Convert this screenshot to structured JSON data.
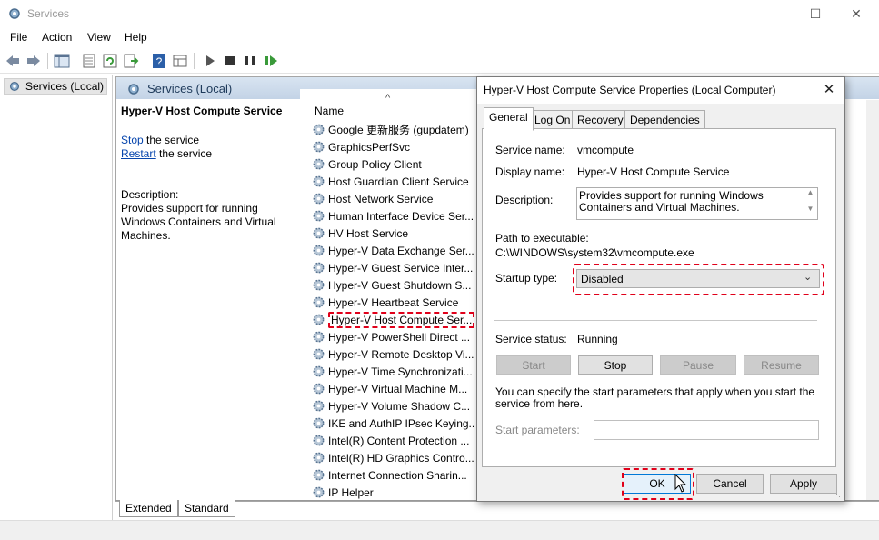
{
  "window": {
    "title": "Services",
    "controls": [
      "minimize",
      "maximize",
      "close"
    ]
  },
  "menu": [
    "File",
    "Action",
    "View",
    "Help"
  ],
  "toolbar": {
    "icons": [
      "back-icon",
      "forward-icon",
      "show-hide-tree-icon",
      "properties-icon",
      "refresh-icon",
      "export-icon",
      "help-icon",
      "view-icon",
      "start-icon",
      "stop-icon",
      "pause-icon",
      "restart-icon"
    ]
  },
  "tree": {
    "root": "Services (Local)"
  },
  "pane": {
    "title": "Services (Local)",
    "selected_service": "Hyper-V Host Compute Service",
    "stop_link": "Stop",
    "stop_suffix": " the service",
    "restart_link": "Restart",
    "restart_suffix": " the service",
    "description_label": "Description:",
    "description_text": "Provides support for running Windows Containers and Virtual Machines.",
    "column_name": "Name",
    "services": [
      "Google 更新服务 (gupdatem)",
      "GraphicsPerfSvc",
      "Group Policy Client",
      "Host Guardian Client Service",
      "Host Network Service",
      "Human Interface Device Ser...",
      "HV Host Service",
      "Hyper-V Data Exchange Ser...",
      "Hyper-V Guest Service Inter...",
      "Hyper-V Guest Shutdown S...",
      "Hyper-V Heartbeat Service",
      "Hyper-V Host Compute Ser...",
      "Hyper-V PowerShell Direct ...",
      "Hyper-V Remote Desktop Vi...",
      "Hyper-V Time Synchronizati...",
      "Hyper-V Virtual Machine M...",
      "Hyper-V Volume Shadow C...",
      "IKE and AuthIP IPsec Keying...",
      "Intel(R) Content Protection ...",
      "Intel(R) HD Graphics Contro...",
      "Internet Connection Sharin...",
      "IP Helper"
    ],
    "highlighted_index": 11
  },
  "bottom_tabs": [
    "Extended",
    "Standard"
  ],
  "dialog": {
    "title": "Hyper-V Host Compute Service Properties (Local Computer)",
    "tabs": [
      "General",
      "Log On",
      "Recovery",
      "Dependencies"
    ],
    "active_tab": "General",
    "service_name_label": "Service name:",
    "service_name": "vmcompute",
    "display_name_label": "Display name:",
    "display_name": "Hyper-V Host Compute Service",
    "description_label": "Description:",
    "description": "Provides support for running Windows Containers and Virtual Machines.",
    "path_label": "Path to executable:",
    "path": "C:\\WINDOWS\\system32\\vmcompute.exe",
    "startup_label": "Startup type:",
    "startup_value": "Disabled",
    "status_label": "Service status:",
    "status_value": "Running",
    "buttons": {
      "start": "Start",
      "stop": "Stop",
      "pause": "Pause",
      "resume": "Resume"
    },
    "params_note": "You can specify the start parameters that apply when you start the service from here.",
    "params_label": "Start parameters:",
    "params_value": "",
    "ok": "OK",
    "cancel": "Cancel",
    "apply": "Apply"
  },
  "colors": {
    "highlight": "#e0001a",
    "pane_header": "#c9d8ea",
    "link": "#0645ad"
  }
}
